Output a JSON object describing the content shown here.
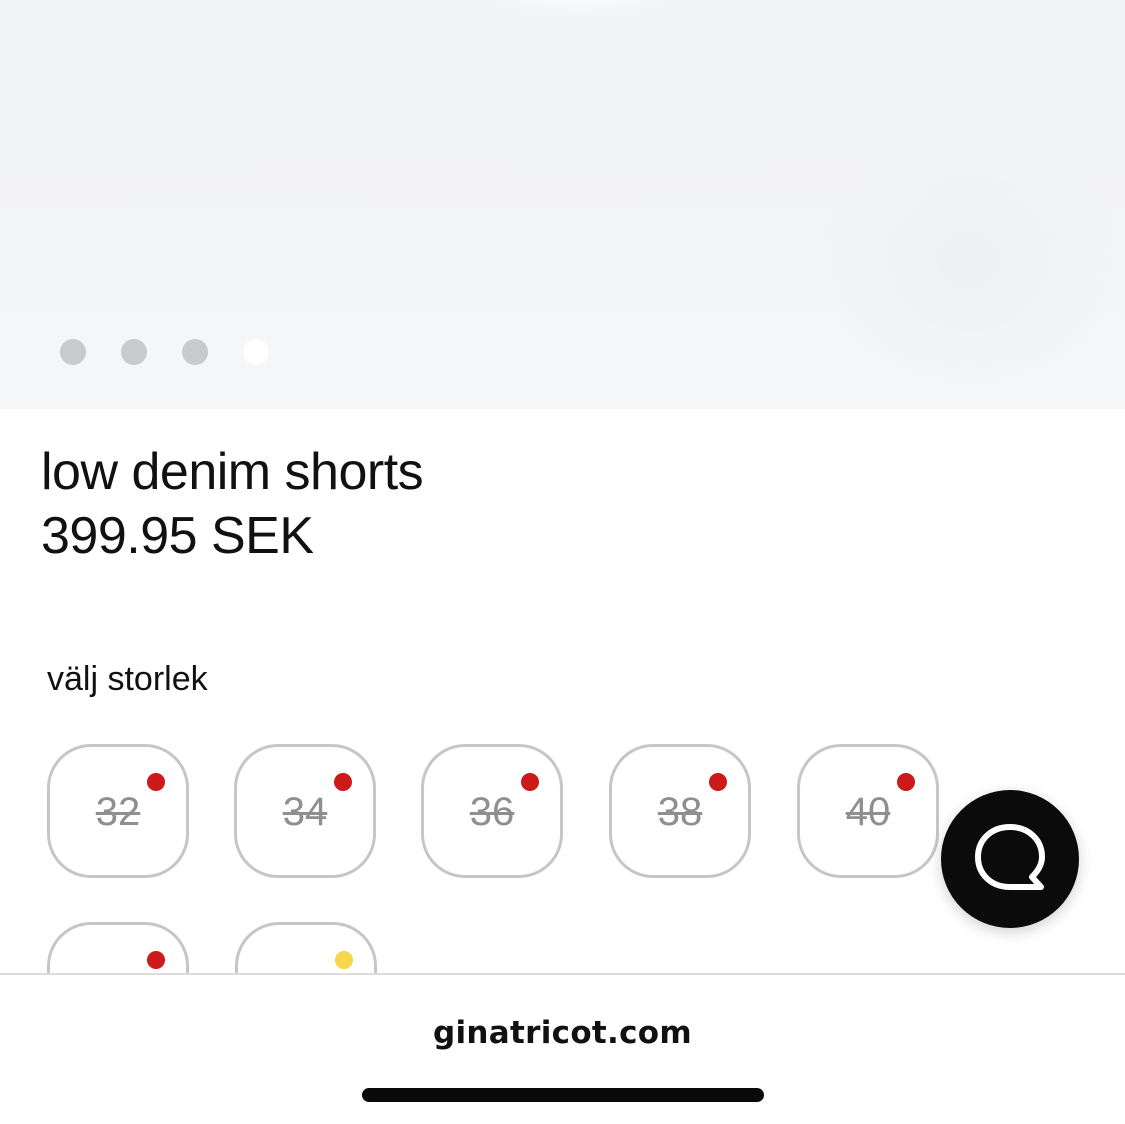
{
  "product": {
    "name": "low denim shorts",
    "price": "399.95 SEK",
    "image_count": 4,
    "active_image_index": 3
  },
  "size_selector": {
    "heading": "välj storlek",
    "sizes": [
      {
        "label": "32",
        "available": false,
        "stock_indicator": "red"
      },
      {
        "label": "34",
        "available": false,
        "stock_indicator": "red"
      },
      {
        "label": "36",
        "available": false,
        "stock_indicator": "red"
      },
      {
        "label": "38",
        "available": false,
        "stock_indicator": "red"
      },
      {
        "label": "40",
        "available": false,
        "stock_indicator": "red"
      },
      {
        "label": "",
        "available": false,
        "stock_indicator": "red"
      },
      {
        "label": "",
        "available": false,
        "stock_indicator": "yellow"
      }
    ]
  },
  "chat": {
    "icon": "chat-bubble-icon"
  },
  "browser": {
    "url": "ginatricot.com"
  },
  "colors": {
    "red": "#cc1a1a",
    "yellow": "#f6d64a",
    "text": "#111111",
    "border": "#c6c6c6",
    "chat_bg": "#0b0b0b"
  }
}
